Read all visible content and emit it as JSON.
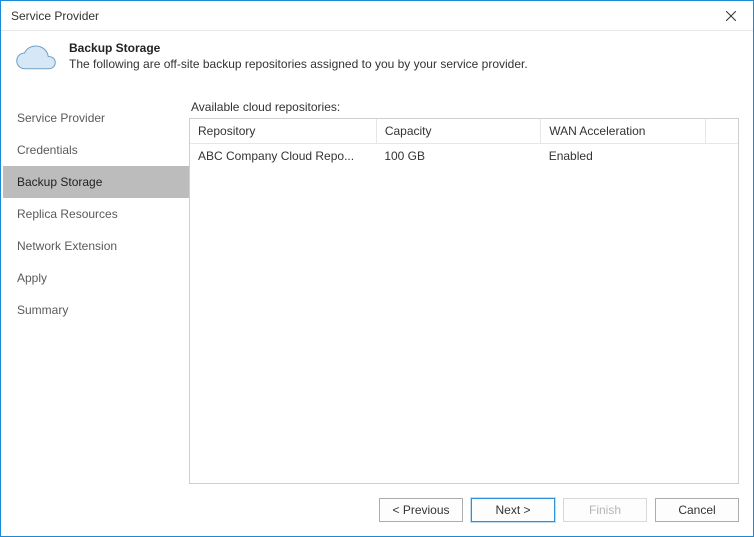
{
  "window": {
    "title": "Service Provider"
  },
  "header": {
    "title": "Backup Storage",
    "subtitle": "The following are off-site backup repositories assigned to you by your service provider."
  },
  "sidebar": {
    "items": [
      {
        "label": "Service Provider",
        "active": false
      },
      {
        "label": "Credentials",
        "active": false
      },
      {
        "label": "Backup Storage",
        "active": true
      },
      {
        "label": "Replica Resources",
        "active": false
      },
      {
        "label": "Network Extension",
        "active": false
      },
      {
        "label": "Apply",
        "active": false
      },
      {
        "label": "Summary",
        "active": false
      }
    ]
  },
  "main": {
    "label": "Available cloud repositories:",
    "columns": [
      {
        "label": "Repository"
      },
      {
        "label": "Capacity"
      },
      {
        "label": "WAN Acceleration"
      }
    ],
    "rows": [
      {
        "repository": "ABC Company Cloud Repo...",
        "capacity": "100 GB",
        "wan": "Enabled"
      }
    ]
  },
  "footer": {
    "previous": "< Previous",
    "next": "Next >",
    "finish": "Finish",
    "cancel": "Cancel"
  }
}
